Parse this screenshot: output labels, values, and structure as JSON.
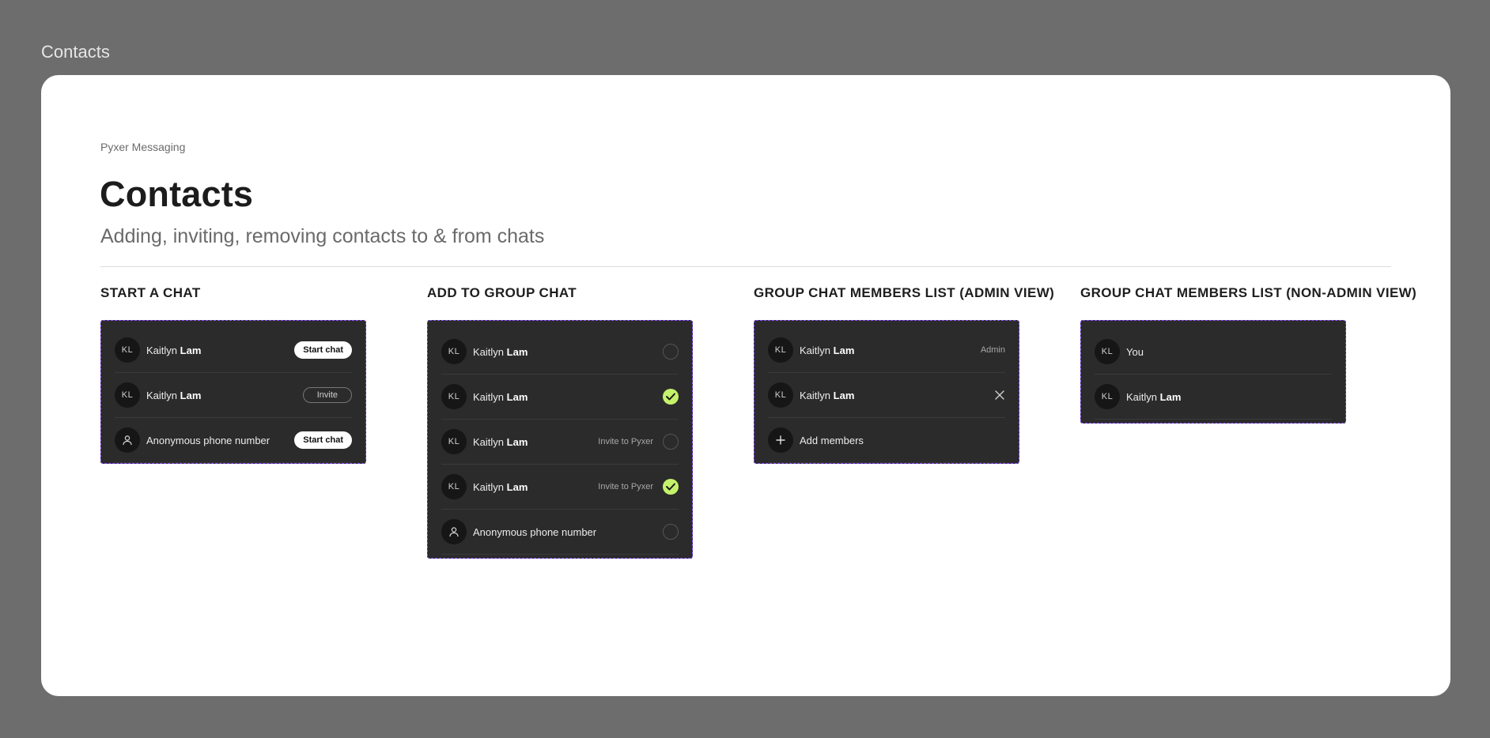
{
  "frame": {
    "title": "Contacts"
  },
  "header": {
    "eyebrow": "Pyxer Messaging",
    "title": "Contacts",
    "subtitle": "Adding, inviting, removing contacts to & from chats"
  },
  "sections": {
    "start_chat": {
      "title": "START A CHAT",
      "rows": [
        {
          "initials": "KL",
          "first": "Kaitlyn",
          "last": "Lam",
          "action": "Start chat"
        },
        {
          "initials": "KL",
          "first": "Kaitlyn",
          "last": "Lam",
          "action": "Invite"
        },
        {
          "icon": "person-icon",
          "label": "Anonymous phone number",
          "action": "Start chat"
        }
      ]
    },
    "add_group": {
      "title": "ADD TO GROUP CHAT",
      "rows": [
        {
          "initials": "KL",
          "first": "Kaitlyn",
          "last": "Lam",
          "note": "",
          "checked": false
        },
        {
          "initials": "KL",
          "first": "Kaitlyn",
          "last": "Lam",
          "note": "",
          "checked": true
        },
        {
          "initials": "KL",
          "first": "Kaitlyn",
          "last": "Lam",
          "note": "Invite to Pyxer",
          "checked": false
        },
        {
          "initials": "KL",
          "first": "Kaitlyn",
          "last": "Lam",
          "note": "Invite to Pyxer",
          "checked": true
        },
        {
          "icon": "person-icon",
          "label": "Anonymous phone number",
          "checked": false
        }
      ]
    },
    "admin_view": {
      "title": "GROUP CHAT MEMBERS LIST (ADMIN VIEW)",
      "rows": [
        {
          "initials": "KL",
          "first": "Kaitlyn",
          "last": "Lam",
          "note": "Admin"
        },
        {
          "initials": "KL",
          "first": "Kaitlyn",
          "last": "Lam",
          "action_icon": "close-icon"
        },
        {
          "icon": "plus-icon",
          "label": "Add members"
        }
      ]
    },
    "non_admin_view": {
      "title": "GROUP CHAT MEMBERS LIST (NON-ADMIN VIEW)",
      "rows": [
        {
          "initials": "KL",
          "label": "You"
        },
        {
          "initials": "KL",
          "first": "Kaitlyn",
          "last": "Lam"
        }
      ]
    }
  },
  "colors": {
    "outer_bg": "#6d6d6d",
    "card_bg": "#ffffff",
    "panel_bg": "#2b2b2b",
    "panel_border": "#8a4dff",
    "check_green": "#c5f26b"
  }
}
